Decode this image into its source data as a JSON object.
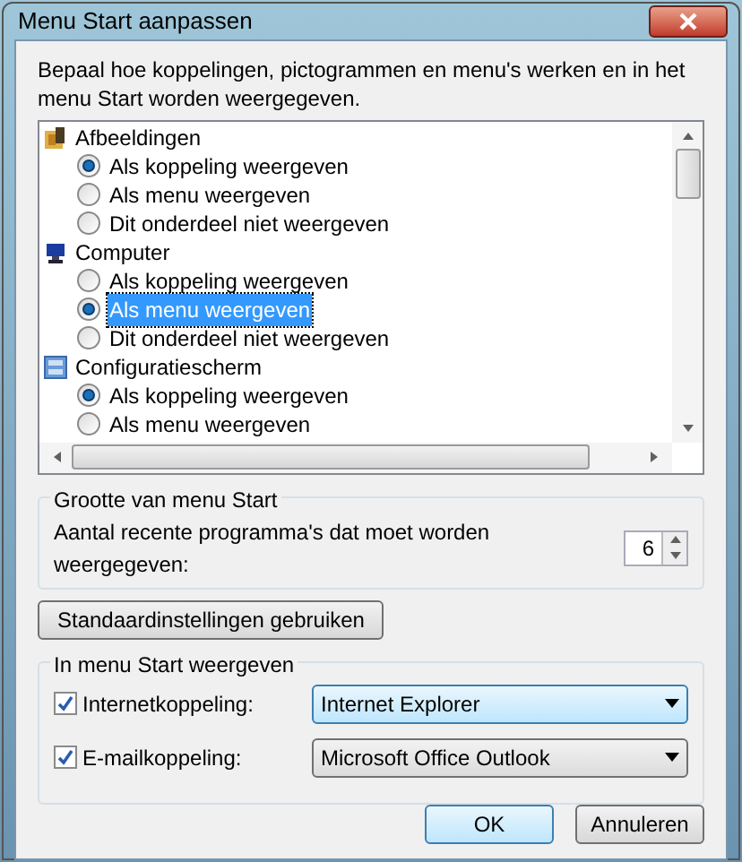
{
  "window": {
    "title": "Menu Start aanpassen"
  },
  "description": "Bepaal hoe koppelingen, pictogrammen en menu's werken en in het menu Start worden weergegeven.",
  "tree": [
    {
      "label": "Afbeeldingen",
      "children": [
        {
          "label": "Als koppeling weergeven",
          "selected": true,
          "focused": false
        },
        {
          "label": "Als menu weergeven",
          "selected": false,
          "focused": false
        },
        {
          "label": "Dit onderdeel niet weergeven",
          "selected": false,
          "focused": false
        }
      ]
    },
    {
      "label": "Computer",
      "children": [
        {
          "label": "Als koppeling weergeven",
          "selected": false,
          "focused": false
        },
        {
          "label": "Als menu weergeven",
          "selected": true,
          "focused": true
        },
        {
          "label": "Dit onderdeel niet weergeven",
          "selected": false,
          "focused": false
        }
      ]
    },
    {
      "label": "Configuratiescherm",
      "children": [
        {
          "label": "Als koppeling weergeven",
          "selected": true,
          "focused": false
        },
        {
          "label": "Als menu weergeven",
          "selected": false,
          "focused": false
        }
      ]
    }
  ],
  "size_group": {
    "title": "Grootte van menu Start",
    "label": "Aantal recente programma's dat moet worden weergegeven:",
    "value": "6"
  },
  "defaults_button": "Standaardinstellingen gebruiken",
  "show_group": {
    "title": "In menu Start weergeven",
    "rows": [
      {
        "label": "Internetkoppeling:",
        "checked": true,
        "value": "Internet Explorer",
        "focused": true
      },
      {
        "label": "E-mailkoppeling:",
        "checked": true,
        "value": "Microsoft Office Outlook",
        "focused": false
      }
    ]
  },
  "buttons": [
    {
      "label": "OK",
      "default": true
    },
    {
      "label": "Annuleren",
      "default": false
    }
  ]
}
